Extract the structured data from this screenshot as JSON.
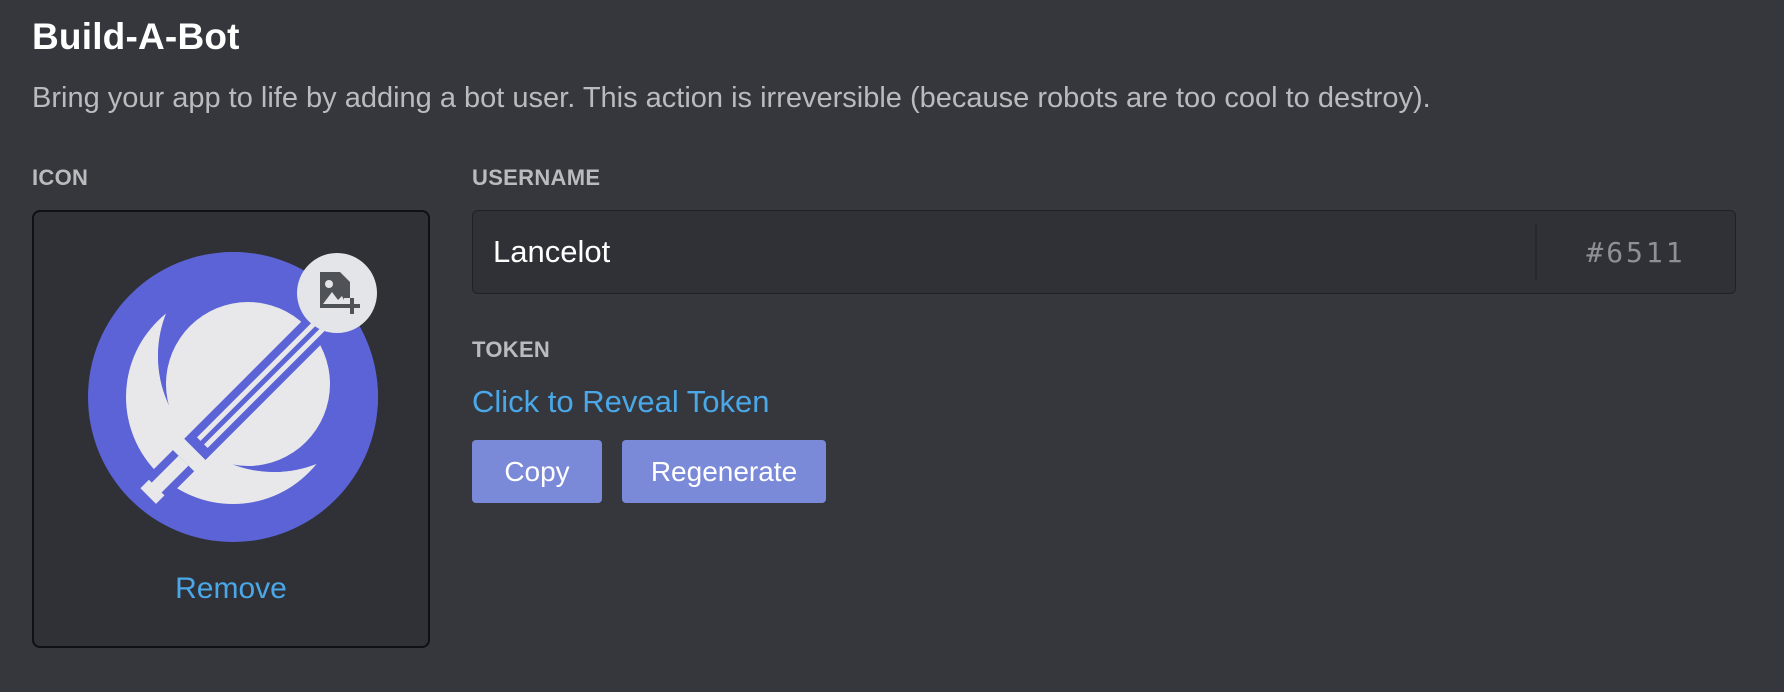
{
  "header": {
    "title": "Build-A-Bot",
    "description": "Bring your app to life by adding a bot user. This action is irreversible (because robots are too cool to destroy)."
  },
  "icon_section": {
    "label": "ICON",
    "remove_label": "Remove",
    "avatar_icon": "crescent-moon-sword-icon",
    "upload_icon": "image-add-icon"
  },
  "username_section": {
    "label": "USERNAME",
    "value": "Lancelot",
    "discriminator": "#6511"
  },
  "token_section": {
    "label": "TOKEN",
    "reveal_label": "Click to Reveal Token",
    "copy_label": "Copy",
    "regenerate_label": "Regenerate"
  },
  "colors": {
    "background": "#36373d",
    "avatar_bg": "#5b63d6",
    "link": "#4aa7e8",
    "button": "#7a8ad9"
  }
}
